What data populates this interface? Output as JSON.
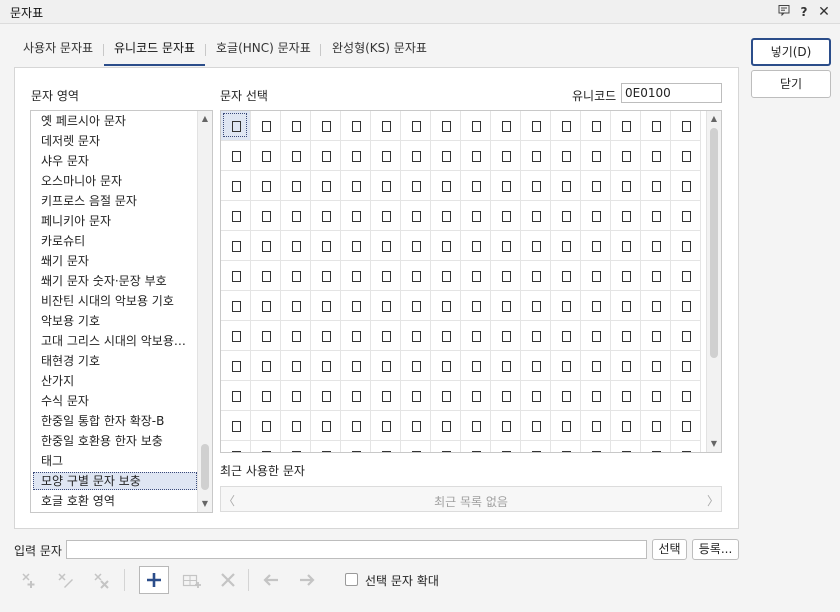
{
  "window": {
    "title": "문자표"
  },
  "tabs": [
    {
      "label": "사용자 문자표"
    },
    {
      "label": "유니코드 문자표"
    },
    {
      "label": "호글(HNC) 문자표"
    },
    {
      "label": "완성형(KS) 문자표"
    }
  ],
  "active_tab": "유니코드 문자표",
  "area": {
    "label": "문자 영역",
    "items": [
      "옛 페르시아 문자",
      "데저렛 문자",
      "샤우 문자",
      "오스마니아 문자",
      "키프로스 음절 문자",
      "페니키아 문자",
      "카로슈티",
      "쐐기 문자",
      "쐐기 문자 숫자·문장 부호",
      "비잔틴 시대의 악보용 기호",
      "악보용 기호",
      "고대 그리스 시대의 악보용…",
      "태현경 기호",
      "산가지",
      "수식 문자",
      "한중일 통합 한자 확장-B",
      "한중일 호환용 한자 보충",
      "태그",
      "모양 구별 문자 보충",
      "호글 호환 영역"
    ],
    "selected": "모양 구별 문자 보충"
  },
  "charset": {
    "label": "문자 선택",
    "unicode_label": "유니코드",
    "unicode_value": "0E0100"
  },
  "recent": {
    "label": "최근 사용한 문자",
    "empty_text": "최근 목록 없음",
    "prev_glyph": "〈",
    "next_glyph": "〉"
  },
  "input": {
    "label": "입력 문자",
    "value": ""
  },
  "buttons": {
    "insert": "넣기(D)",
    "close": "닫기",
    "select": "선택",
    "register": "등록..."
  },
  "enlarge": {
    "label": "선택 문자 확대",
    "checked": false
  },
  "icons": {
    "window": [
      "comment-icon",
      "help-icon",
      "close-icon"
    ],
    "toolbar": [
      "add-to-user-set-icon",
      "edit-user-set-icon",
      "delete-user-set-icon",
      "add-icon",
      "insert-row-icon",
      "delete-icon",
      "left-arrow-icon",
      "right-arrow-icon"
    ]
  },
  "colors": {
    "accent": "#2b4d8a",
    "selection": "#dfe6f3"
  }
}
